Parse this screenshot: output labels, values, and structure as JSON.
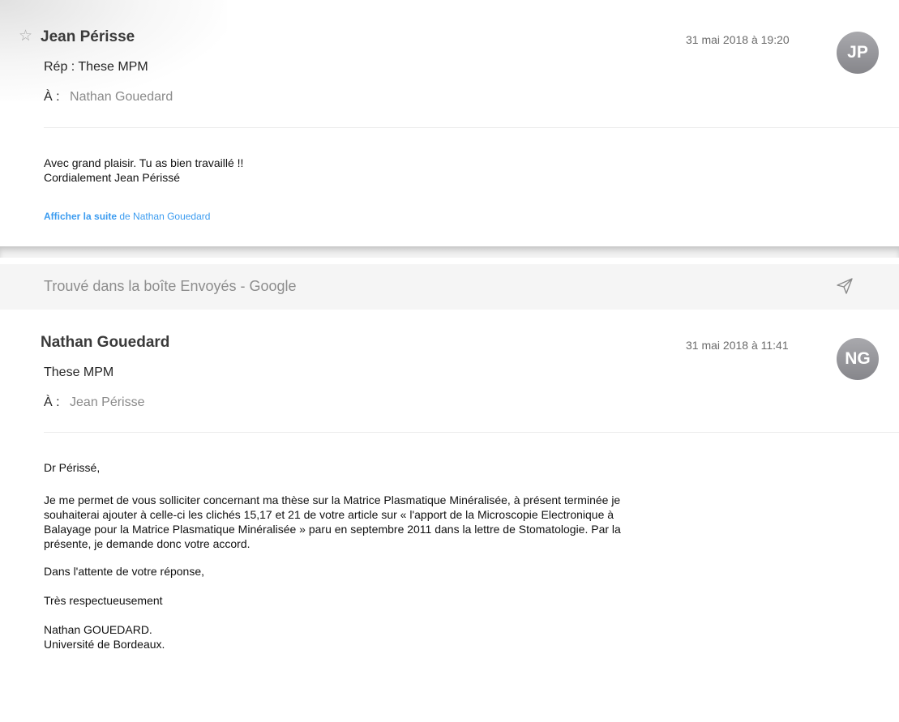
{
  "message1": {
    "sender": "Jean Périsse",
    "date": "31 mai 2018 à 19:20",
    "subject": "Rép : These MPM",
    "to_label": "À :",
    "to_name": "Nathan Gouedard",
    "avatar_initials": "JP",
    "body": [
      "Avec grand plaisir. Tu as bien travaillé !!",
      "Cordialement Jean Périssé"
    ],
    "show_more_link": "Afficher la suite",
    "show_more_rest": " de Nathan Gouedard",
    "star_icon": "star-outline-icon"
  },
  "found_bar": {
    "text": "Trouvé dans la boîte Envoyés - Google",
    "icon": "send-icon"
  },
  "message2": {
    "sender": "Nathan Gouedard",
    "date": "31 mai 2018 à 11:41",
    "subject": "These MPM",
    "to_label": "À :",
    "to_name": "Jean Périsse",
    "avatar_initials": "NG",
    "body": {
      "greeting": "Dr Périssé,",
      "p1_l1": "Je me permet de vous solliciter concernant ma thèse sur la Matrice Plasmatique Minéralisée, à présent terminée je",
      "p1_l2": "souhaiterai ajouter à celle-ci les clichés 15,17 et 21 de votre article sur « l'apport de la Microscopie Electronique à",
      "p1_l3": "Balayage pour la Matrice Plasmatique Minéralisée » paru en septembre 2011 dans la lettre de Stomatologie. Par la",
      "p1_l4": "présente, je demande donc votre accord.",
      "p2": "Dans l'attente de votre réponse,",
      "p3": "Très respectueusement",
      "sig1": "Nathan GOUEDARD.",
      "sig2": "Université de Bordeaux."
    }
  },
  "colors": {
    "link": "#3c9cf0",
    "avatar": "#98989d",
    "found_bar_bg": "#f5f5f5"
  }
}
